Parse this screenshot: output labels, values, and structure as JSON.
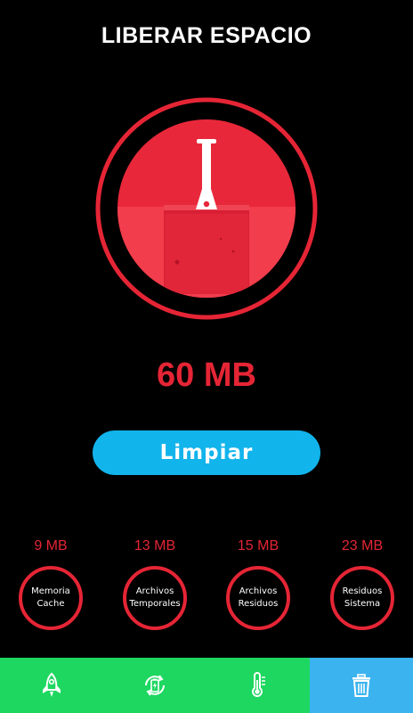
{
  "header": {
    "title": "LIBERAR ESPACIO"
  },
  "cleaner": {
    "size_label": "60 MB",
    "clean_button_label": "Limpiar"
  },
  "categories": [
    {
      "size": "9 MB",
      "line1": "Memoria",
      "line2": "Cache"
    },
    {
      "size": "13 MB",
      "line1": "Archivos",
      "line2": "Temporales"
    },
    {
      "size": "15 MB",
      "line1": "Archivos",
      "line2": "Residuos"
    },
    {
      "size": "23 MB",
      "line1": "Residuos",
      "line2": "Sistema"
    }
  ],
  "navbar": {
    "items": [
      {
        "icon": "rocket-icon"
      },
      {
        "icon": "battery-recycle-icon"
      },
      {
        "icon": "thermometer-icon"
      },
      {
        "icon": "trash-icon",
        "active": true
      }
    ]
  },
  "colors": {
    "accent_red": "#e52535",
    "button_blue": "#12b4ec",
    "nav_green": "#1ed760",
    "nav_active_blue": "#3bb3ef"
  }
}
